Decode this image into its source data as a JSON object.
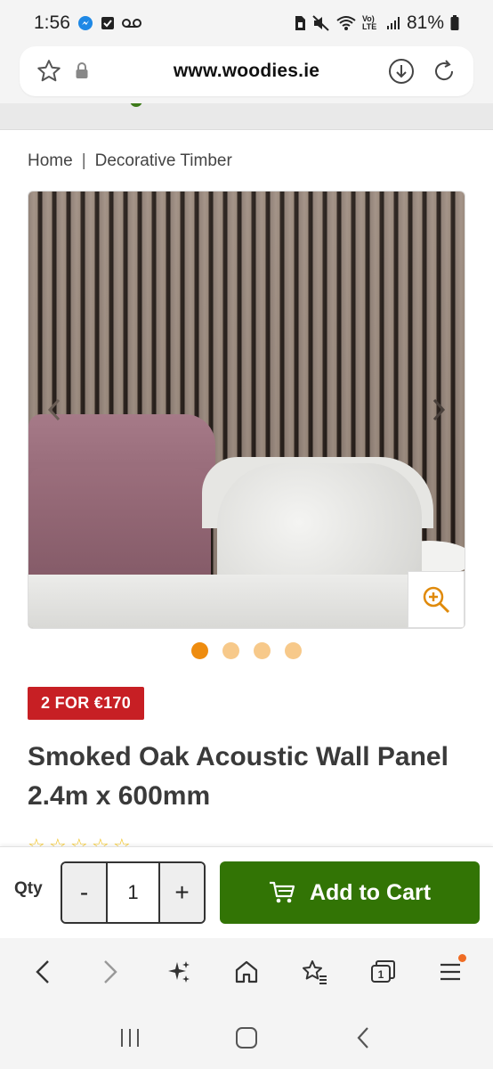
{
  "status_bar": {
    "time": "1:56",
    "battery": "81%",
    "network_label": "Vo) LTE"
  },
  "browser": {
    "url": "www.woodies.ie",
    "icons": [
      "star-icon",
      "lock-icon",
      "download-icon",
      "reload-icon"
    ]
  },
  "breadcrumb": {
    "items": [
      "Home",
      "Decorative Timber"
    ],
    "separator": "|"
  },
  "product": {
    "image_count": 4,
    "active_image": 1,
    "promo_badge": "2 FOR €170",
    "title": "Smoked Oak Acoustic Wall Panel 2.4m x 600mm",
    "title_line1": "Smoked Oak Acoustic Wall Panel",
    "title_line2": "2.4m x 600mm"
  },
  "cart_bar": {
    "qty_label": "Qty",
    "decrement_label": "-",
    "quantity": "1",
    "increment_label": "+",
    "add_to_cart_label": "Add to Cart"
  },
  "browser_nav": {
    "tab_count": "1",
    "items": [
      "back-icon",
      "forward-icon",
      "ai-sparkle-icon",
      "home-icon",
      "bookmarks-icon",
      "tabs-icon",
      "menu-icon"
    ]
  },
  "colors": {
    "brand_green": "#327405",
    "promo_red": "#c71f24",
    "dot_active": "#ee8c0f",
    "dot_inactive": "#f7c98a"
  }
}
